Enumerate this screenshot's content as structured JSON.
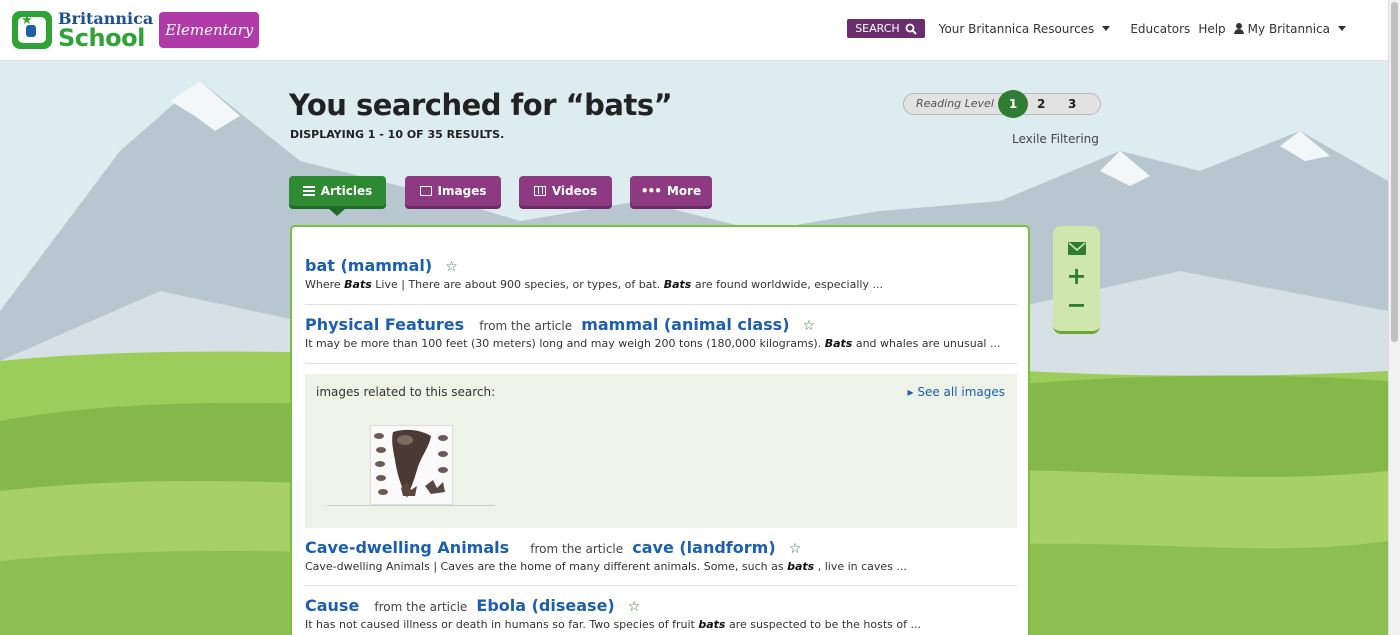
{
  "header": {
    "logo": {
      "brand": "Britannica",
      "product": "School",
      "badge": "Elementary"
    },
    "nav": {
      "search_label": "SEARCH",
      "resources_label": "Your Britannica Resources",
      "educators_label": "Educators",
      "help_label": "Help",
      "account_label": "My Britannica"
    }
  },
  "search": {
    "title": "You searched for “bats”",
    "results_summary": "DISPLAYING 1 - 10 OF 35 RESULTS."
  },
  "reading_level": {
    "label": "Reading Level",
    "levels": [
      "1",
      "2",
      "3"
    ],
    "selected": "1",
    "lexile_label": "Lexile Filtering"
  },
  "tabs": [
    {
      "label": "Articles",
      "icon": "list-icon",
      "active": true
    },
    {
      "label": "Images",
      "icon": "image-icon",
      "active": false
    },
    {
      "label": "Videos",
      "icon": "film-icon",
      "active": false
    },
    {
      "label": "More",
      "icon": "ellipsis-icon",
      "active": false
    }
  ],
  "results": [
    {
      "title": "bat (mammal)",
      "from_prefix": "",
      "from_article": "",
      "snippet_parts": [
        "Where ",
        "Bats",
        " Live  | There are about 900 species, or types, of bat. ",
        "Bats",
        " are found worldwide, especially ..."
      ]
    },
    {
      "title": "Physical Features",
      "from_prefix": "from the article",
      "from_article": "mammal (animal class)",
      "snippet_parts": [
        "It may be more than 100 feet (30 meters) long and may weigh 200 tons (180,000 kilograms).  ",
        "Bats",
        " and whales are unusual ..."
      ]
    },
    {
      "title": "Cave-dwelling Animals",
      "from_prefix": "from the article",
      "from_article": "cave (landform)",
      "snippet_parts": [
        "Cave-dwelling Animals   | Caves are the home of many different animals. Some, such as ",
        "bats",
        " , live in caves ..."
      ]
    },
    {
      "title": "Cause",
      "from_prefix": "from the article",
      "from_article": "Ebola (disease)",
      "snippet_parts": [
        "It has not caused illness or death in humans so far.  Two species of fruit ",
        "bats",
        " are suspected to be the hosts of ..."
      ]
    }
  ],
  "images_related": {
    "label": "images related to this search:",
    "see_all": "See all images"
  },
  "tools": {
    "email_icon": "envelope-icon",
    "zoom_in": "+",
    "zoom_out": "−"
  },
  "colors": {
    "green": "#2e8b34",
    "purple": "#8e3a83",
    "link_blue": "#1c5fb0",
    "panel_border": "#7bbf42"
  }
}
